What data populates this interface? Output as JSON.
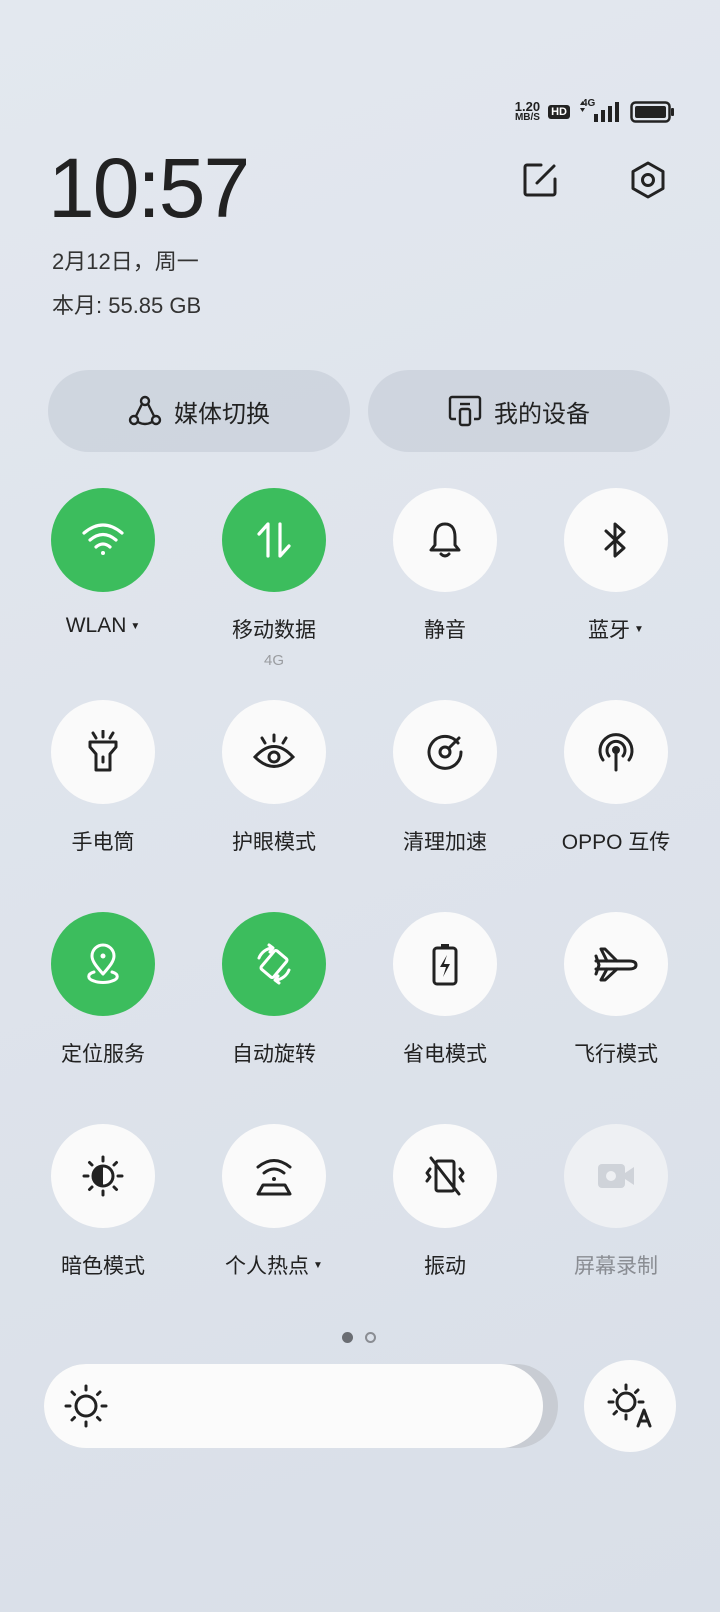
{
  "status_bar": {
    "net_speed_value": "1.20",
    "net_speed_unit": "MB/S",
    "hd_badge": "HD",
    "network_type": "4G"
  },
  "header": {
    "time": "10:57",
    "date": "2月12日，周一",
    "data_usage": "本月: 55.85 GB"
  },
  "media_buttons": [
    {
      "label": "媒体切换",
      "icon": "media-switch-icon"
    },
    {
      "label": "我的设备",
      "icon": "my-devices-icon"
    }
  ],
  "tiles": [
    {
      "label": "WLAN",
      "state": "on",
      "dropdown": true,
      "icon": "wifi-icon"
    },
    {
      "label": "移动数据",
      "sublabel": "4G",
      "state": "on",
      "icon": "mobile-data-icon"
    },
    {
      "label": "静音",
      "state": "off",
      "icon": "bell-icon"
    },
    {
      "label": "蓝牙",
      "state": "off",
      "dropdown": true,
      "icon": "bluetooth-icon"
    },
    {
      "label": "手电筒",
      "state": "off",
      "icon": "flashlight-icon"
    },
    {
      "label": "护眼模式",
      "state": "off",
      "icon": "eye-icon"
    },
    {
      "label": "清理加速",
      "state": "off",
      "icon": "clean-boost-icon"
    },
    {
      "label": "OPPO 互传",
      "state": "off",
      "icon": "share-icon"
    },
    {
      "label": "定位服务",
      "state": "on",
      "icon": "location-icon"
    },
    {
      "label": "自动旋转",
      "state": "on",
      "icon": "rotate-icon"
    },
    {
      "label": "省电模式",
      "state": "off",
      "icon": "battery-saver-icon"
    },
    {
      "label": "飞行模式",
      "state": "off",
      "icon": "airplane-icon"
    },
    {
      "label": "暗色模式",
      "state": "off",
      "icon": "dark-mode-icon"
    },
    {
      "label": "个人热点",
      "state": "off",
      "dropdown": true,
      "icon": "hotspot-icon"
    },
    {
      "label": "振动",
      "state": "off",
      "icon": "vibrate-icon"
    },
    {
      "label": "屏幕录制",
      "state": "disabled",
      "icon": "screen-record-icon"
    }
  ],
  "colors": {
    "accent": "#3cbd5d",
    "tile_off": "#fafafa",
    "tile_disabled": "#eef0f3"
  },
  "pager": {
    "pages": 2,
    "active": 1
  },
  "brightness": {
    "level_percent": 97
  }
}
